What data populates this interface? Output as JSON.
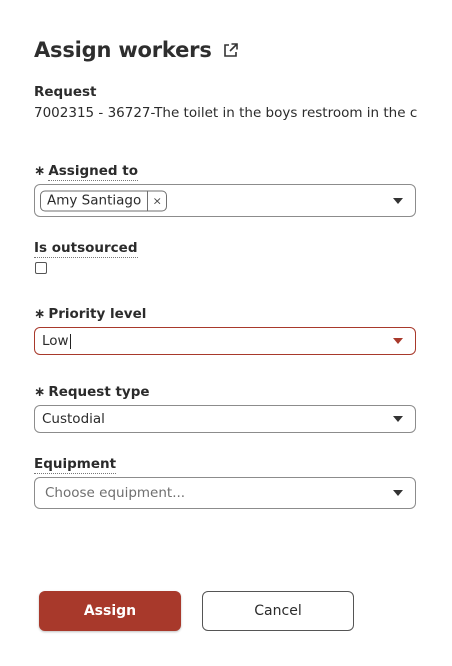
{
  "dialog": {
    "title": "Assign workers",
    "title_icon": "external-link-icon"
  },
  "request": {
    "label": "Request",
    "value": "7002315 - 36727-The toilet in the boys restroom in the c"
  },
  "assigned_to": {
    "required_mark": "∗",
    "label": "Assigned to",
    "chips": [
      {
        "label": "Amy Santiago",
        "remove": "×"
      }
    ]
  },
  "is_outsourced": {
    "label": "Is outsourced",
    "checked": false
  },
  "priority_level": {
    "required_mark": "∗",
    "label": "Priority level",
    "value": "Low",
    "state": "error"
  },
  "request_type": {
    "required_mark": "∗",
    "label": "Request type",
    "value": "Custodial"
  },
  "equipment": {
    "label": "Equipment",
    "placeholder": "Choose equipment..."
  },
  "actions": {
    "assign_label": "Assign",
    "cancel_label": "Cancel"
  },
  "colors": {
    "primary": "#a8392b",
    "error_border": "#a8392b",
    "text": "#2b2b2b"
  }
}
